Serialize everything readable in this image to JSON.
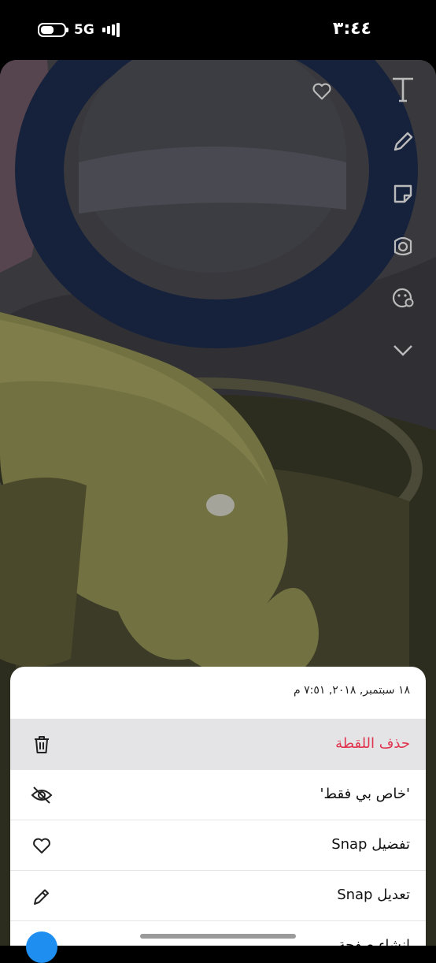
{
  "status_bar": {
    "time": "٣:٤٤",
    "network": "5G"
  },
  "sheet": {
    "date": "١٨ سبتمبر, ٢٠١٨, ٧:٥١ م",
    "items": [
      {
        "label": "حذف اللقطة",
        "icon": "trash-icon"
      },
      {
        "label": "'خاص بي فقط'",
        "icon": "eye-slash-icon"
      },
      {
        "label": "تفضيل Snap",
        "icon": "heart-icon"
      },
      {
        "label": "تعديل Snap",
        "icon": "pencil-icon"
      },
      {
        "label": "إنشاء صفحة ...",
        "icon": "user-icon"
      }
    ]
  },
  "colors": {
    "danger": "#e0344e",
    "sheet_bg": "#ffffff",
    "highlight": "#e4e4e6"
  },
  "tools": [
    "text-tool-icon",
    "pencil-tool-icon",
    "sticker-tool-icon",
    "scissors-tool-icon",
    "emoji-tool-icon",
    "chevron-down-icon"
  ]
}
